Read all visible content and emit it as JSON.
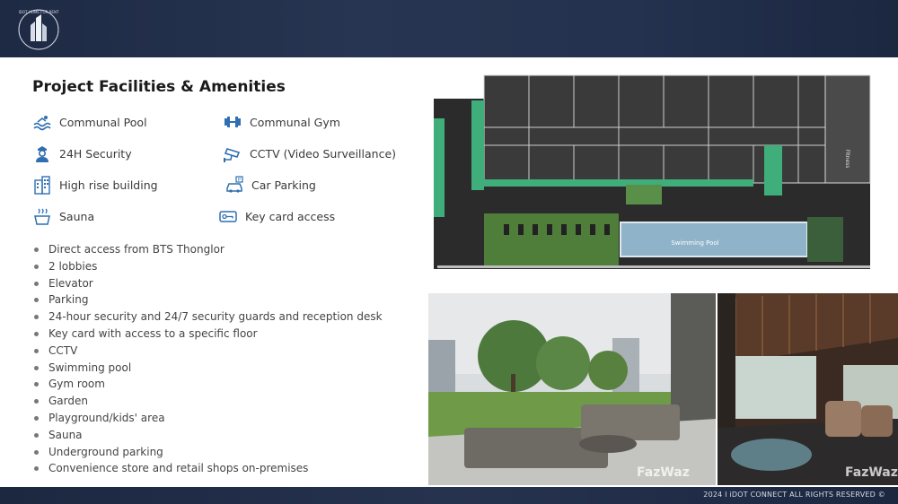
{
  "header": {
    "logo_text": "IDOT HOME FOR RENT"
  },
  "title": "Project Facilities & Amenities",
  "amenities": [
    {
      "label": "Communal Pool",
      "icon": "pool-icon"
    },
    {
      "label": "Communal Gym",
      "icon": "dumbbell-icon"
    },
    {
      "label": "24H Security",
      "icon": "security-guard-icon"
    },
    {
      "label": "CCTV (Video Surveillance)",
      "icon": "cctv-camera-icon"
    },
    {
      "label": "High rise building",
      "icon": "building-icon"
    },
    {
      "label": "Car Parking",
      "icon": "car-parking-icon"
    },
    {
      "label": "Sauna",
      "icon": "sauna-icon"
    },
    {
      "label": "Key card access",
      "icon": "key-card-icon"
    }
  ],
  "features": [
    "Direct access from BTS Thonglor",
    "2 lobbies",
    "Elevator",
    "Parking",
    "24-hour security and 24/7 security guards and reception desk",
    "Key card with access to a specific floor",
    "CCTV",
    "Swimming pool",
    "Gym room",
    "Garden",
    "Playground/kids' area",
    "Sauna",
    "Underground parking",
    "Convenience store and retail shops on-premises"
  ],
  "floorplan": {
    "pool_label": "Swimming Pool",
    "fitness_label": "Fitness"
  },
  "photos": {
    "watermark_1": "FazWaz",
    "watermark_2": "FazWaz"
  },
  "footer": {
    "text": "2024 I iDOT CONNECT  ALL RIGHTS RESERVED ©"
  },
  "colors": {
    "header_bg": "#24324f",
    "accent_green": "#3fae7a"
  }
}
